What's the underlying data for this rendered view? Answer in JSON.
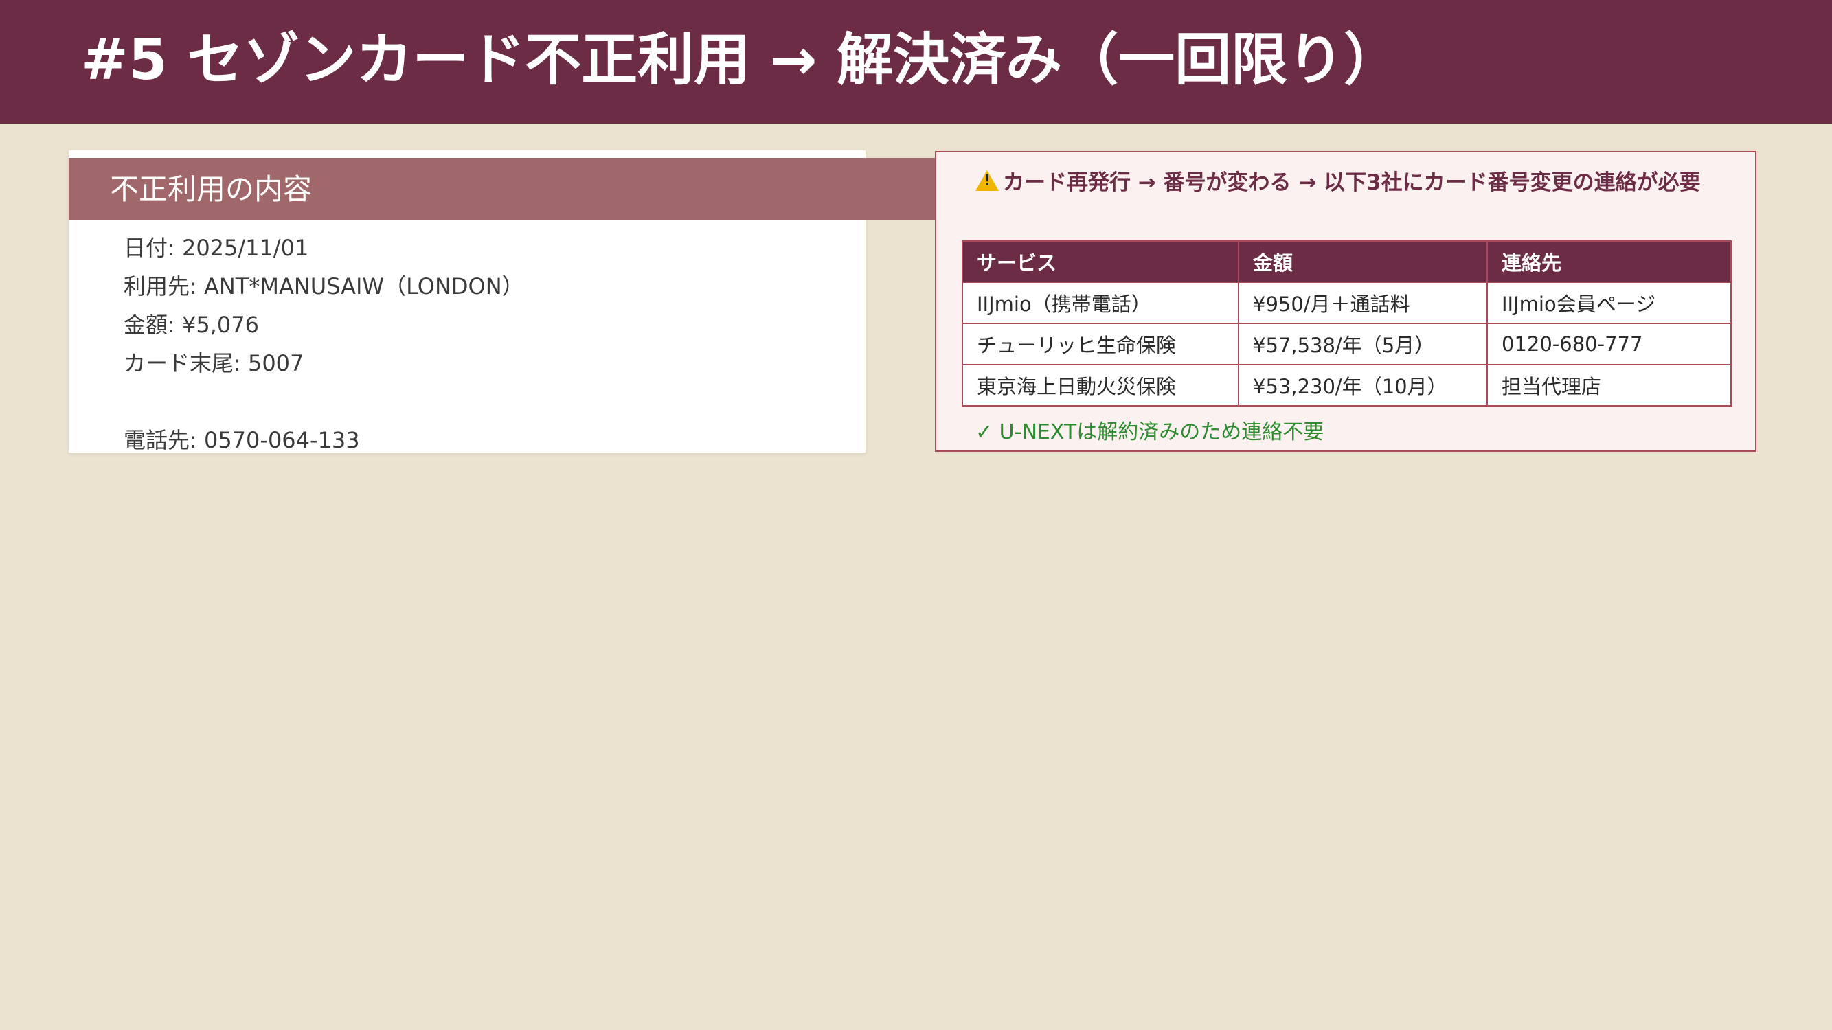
{
  "title": "#5 セゾンカード不正利用 → 解決済み（一回限り）",
  "left_panel": {
    "heading": "不正利用の内容",
    "lines": [
      "日付: 2025/11/01",
      "利用先: ANT*MANUSAIW（LONDON）",
      "金額: ¥5,076",
      "カード末尾: 5007"
    ],
    "phone": "電話先: 0570-064-133"
  },
  "right_panel": {
    "warning_icon": "warning-icon",
    "warning": "カード再発行 → 番号が変わる → 以下3社にカード番号変更の連絡が必要",
    "table": {
      "headers": [
        "サービス",
        "金額",
        "連絡先"
      ],
      "rows": [
        [
          "IIJmio（携帯電話）",
          "¥950/月＋通話料",
          "IIJmio会員ページ"
        ],
        [
          "チューリッヒ生命保険",
          "¥57,538/年（5月）",
          "0120-680-777"
        ],
        [
          "東京海上日動火災保険",
          "¥53,230/年（10月）",
          "担当代理店"
        ]
      ]
    },
    "note": "✓ U-NEXTは解約済みのため連絡不要"
  },
  "colors": {
    "header_bg": "#6d2c45",
    "band_bg": "#a0686a",
    "page_bg": "#ebe3d0",
    "ok_green": "#2e8b2e"
  }
}
